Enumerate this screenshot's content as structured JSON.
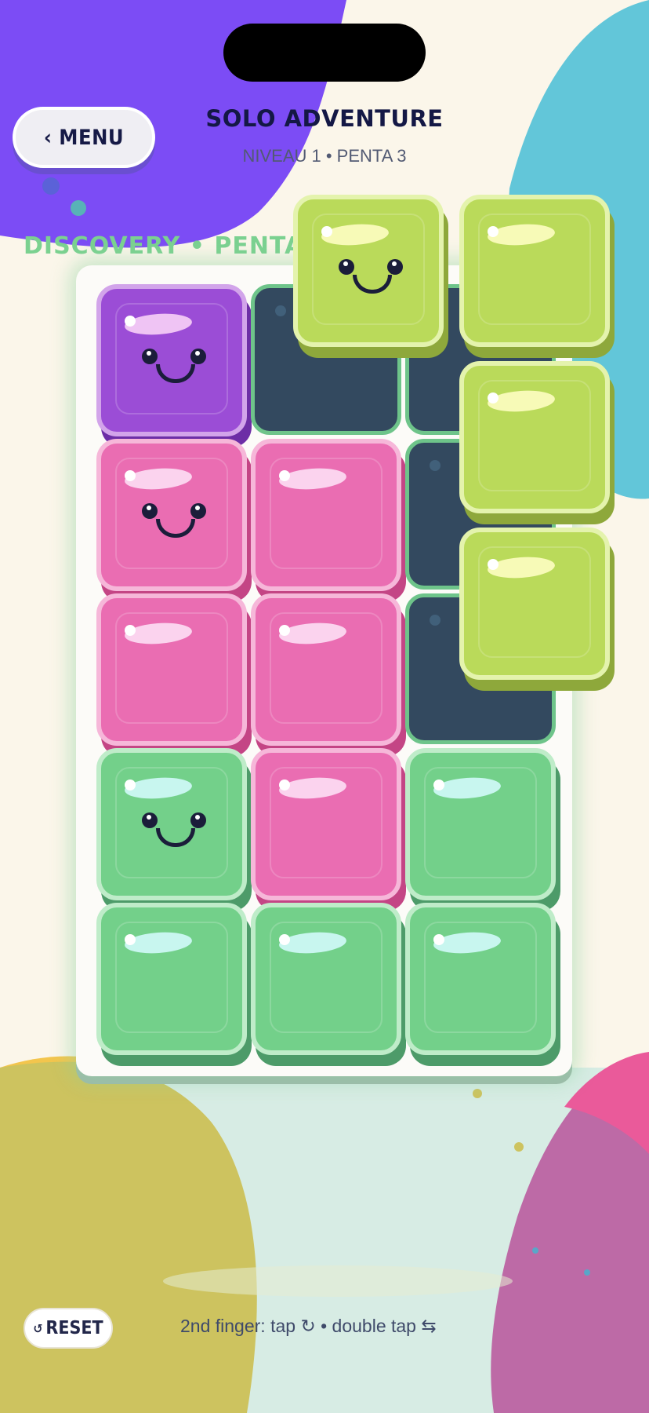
{
  "header": {
    "menu_label": "‹ MENU",
    "title": "SOLO ADVENTURE",
    "subtitle": "NIVEAU 1 • PENTA 3"
  },
  "mode_label": "DISCOVERY • PENTA",
  "board": {
    "rows": 5,
    "cols": 3,
    "grid": [
      [
        "purple",
        "empty",
        "empty"
      ],
      [
        "pink",
        "pink",
        "empty"
      ],
      [
        "pink",
        "pink",
        "empty"
      ],
      [
        "green",
        "pink",
        "green"
      ],
      [
        "green",
        "green",
        "green"
      ]
    ]
  },
  "active_piece": {
    "color": "lime",
    "cells": 4
  },
  "footer": {
    "reset_icon": "↺",
    "reset_label": "RESET",
    "hint": "2nd finger: tap ↻  •  double tap ⇆"
  },
  "colors": {
    "purple": "#9b4dd6",
    "pink": "#ea6db2",
    "green": "#73d08a",
    "lime": "#bada5a",
    "slot": "#33495f",
    "accent_purple_bg": "#7c4cf5",
    "accent_cyan_bg": "#62c6d9",
    "title_navy": "#141845"
  }
}
